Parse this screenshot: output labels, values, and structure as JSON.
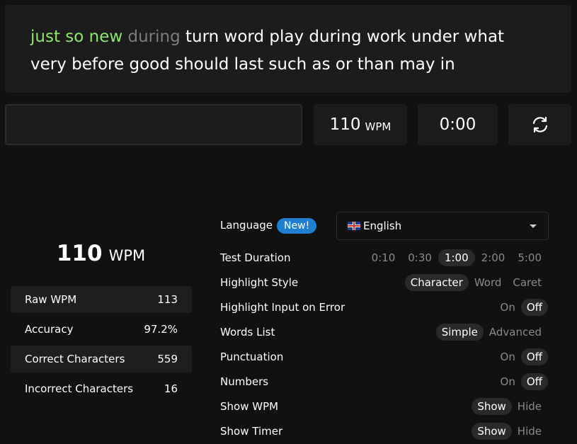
{
  "words": {
    "typed": "just so new ",
    "current": "during",
    "upcoming_line1": " turn word play during work under what",
    "upcoming_line2": "very before good should last such as or than may in"
  },
  "stats": {
    "wpm_value": "110",
    "wpm_unit": "WPM",
    "timer": "0:00",
    "restart_icon": "restart-icon"
  },
  "results": {
    "wpm_value": "110",
    "wpm_unit": "WPM",
    "rows": [
      {
        "label": "Raw WPM",
        "value": "113"
      },
      {
        "label": "Accuracy",
        "value": "97.2%"
      },
      {
        "label": "Correct Characters",
        "value": "559"
      },
      {
        "label": "Incorrect Characters",
        "value": "16"
      }
    ]
  },
  "settings": {
    "language": {
      "label": "Language",
      "badge": "New!",
      "selected": "English"
    },
    "test_duration": {
      "label": "Test Duration",
      "options": [
        "0:10",
        "0:30",
        "1:00",
        "2:00",
        "5:00"
      ],
      "selected": "1:00"
    },
    "highlight_style": {
      "label": "Highlight Style",
      "options": [
        "Character",
        "Word",
        "Caret"
      ],
      "selected": "Character"
    },
    "highlight_input_on_error": {
      "label": "Highlight Input on Error",
      "options": [
        "On",
        "Off"
      ],
      "selected": "Off"
    },
    "words_list": {
      "label": "Words List",
      "options": [
        "Simple",
        "Advanced"
      ],
      "selected": "Simple"
    },
    "punctuation": {
      "label": "Punctuation",
      "options": [
        "On",
        "Off"
      ],
      "selected": "Off"
    },
    "numbers": {
      "label": "Numbers",
      "options": [
        "On",
        "Off"
      ],
      "selected": "Off"
    },
    "show_wpm": {
      "label": "Show WPM",
      "options": [
        "Show",
        "Hide"
      ],
      "selected": "Show"
    },
    "show_timer": {
      "label": "Show Timer",
      "options": [
        "Show",
        "Hide"
      ],
      "selected": "Show"
    }
  },
  "colors": {
    "typed_correct": "#8ee66b",
    "current_word": "#7c7c7c",
    "badge": "#1f7fd1",
    "panel_bg": "#1c1c1c",
    "page_bg": "#111111"
  }
}
